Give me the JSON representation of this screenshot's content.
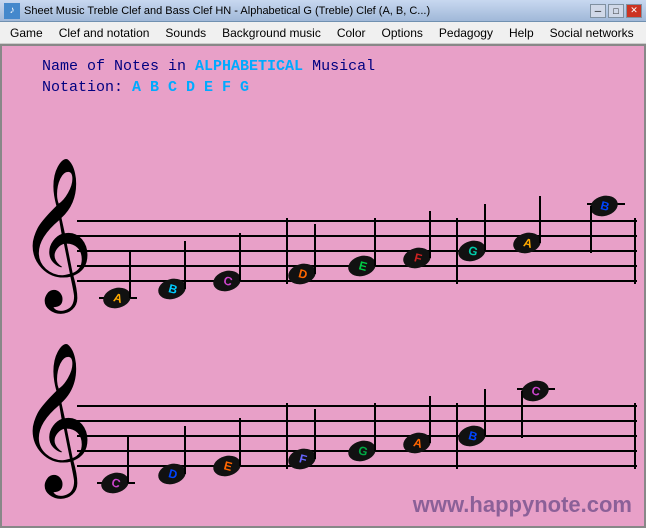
{
  "window": {
    "title": "Sheet Music Treble Clef and Bass Clef HN - Alphabetical G (Treble) Clef (A, B, C...)",
    "icon_label": "♪"
  },
  "titlebar_buttons": {
    "minimize": "─",
    "maximize": "□",
    "close": "✕"
  },
  "menu": {
    "items": [
      "Game",
      "Clef and notation",
      "Sounds",
      "Background music",
      "Color",
      "Options",
      "Pedagogy",
      "Help",
      "Social networks"
    ]
  },
  "content": {
    "title_line1": "Name of Notes in ALPHABETICAL Musical",
    "title_line2": "Notation: A B C D E F G",
    "website": "www.happynote.com"
  },
  "notes_top_staff": [
    {
      "label": "A",
      "color": "#ffaa00"
    },
    {
      "label": "B",
      "color": "#00ccff"
    },
    {
      "label": "C",
      "color": "#cc44cc"
    },
    {
      "label": "D",
      "color": "#ff6600"
    },
    {
      "label": "E",
      "color": "#00cc44"
    },
    {
      "label": "F",
      "color": "#cc2222"
    },
    {
      "label": "G",
      "color": "#00aa88"
    },
    {
      "label": "A",
      "color": "#ffaa00"
    },
    {
      "label": "B",
      "color": "#0044ff"
    }
  ],
  "notes_bottom_staff": [
    {
      "label": "C",
      "color": "#cc44cc"
    },
    {
      "label": "D",
      "color": "#0044ff"
    },
    {
      "label": "E",
      "color": "#ff6600"
    },
    {
      "label": "F",
      "color": "#6666ff"
    },
    {
      "label": "G",
      "color": "#00aa44"
    },
    {
      "label": "A",
      "color": "#ff6600"
    },
    {
      "label": "B",
      "color": "#0044ff"
    },
    {
      "label": "C",
      "color": "#cc44cc"
    }
  ]
}
